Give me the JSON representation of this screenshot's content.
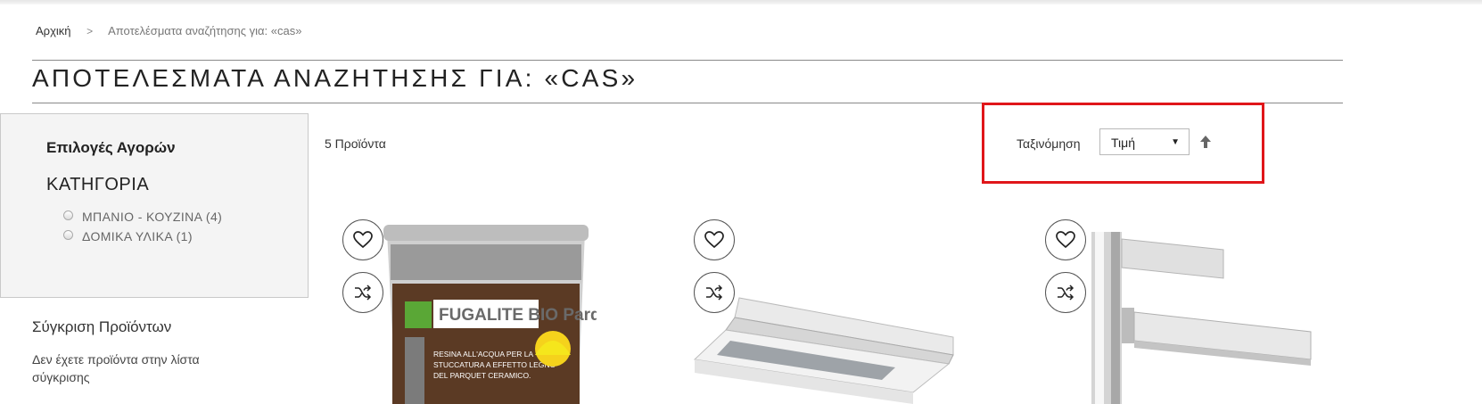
{
  "breadcrumb": {
    "home": "Αρχική",
    "separator": ">",
    "current": "Αποτελέσματα αναζήτησης για: «cas»"
  },
  "page_title": "ΑΠΟΤΕΛΕΣΜΑΤΑ ΑΝΑΖΗΤΗΣΗΣ ΓΙΑ: «CAS»",
  "filters": {
    "title": "Επιλογές Αγορών",
    "category_heading": "ΚΑΤΗΓΟΡΙΑ",
    "options": [
      {
        "label": "ΜΠΑΝΙΟ - ΚΟΥΖΙΝΑ (4)"
      },
      {
        "label": "ΔΟΜΙΚΑ ΥΛΙΚΑ (1)"
      }
    ]
  },
  "compare": {
    "title": "Σύγκριση Προϊόντων",
    "empty_text": "Δεν έχετε προϊόντα στην λίστα σύγκρισης"
  },
  "toolbar": {
    "product_count": "5 Προϊόντα",
    "sort_label": "Ταξινόμηση",
    "sort_selected": "Τιμή",
    "sort_direction_icon": "arrow-up-icon",
    "highlight_color": "#e0161a"
  },
  "products": [
    {
      "name": "fugalite-bio-parquet",
      "image_text": "FUGALITE BIO Parquet",
      "image_subtext": "RESINA ALL'ACQUA PER LA STUCCATURA A EFFETTO LEGNO DEL PARQUET CERAMICO."
    },
    {
      "name": "telescopic-cooker-hood",
      "image_text": ""
    },
    {
      "name": "chrome-basin-faucet",
      "image_text": ""
    }
  ],
  "icons": {
    "wishlist": "heart-icon",
    "compare": "shuffle-icon"
  }
}
